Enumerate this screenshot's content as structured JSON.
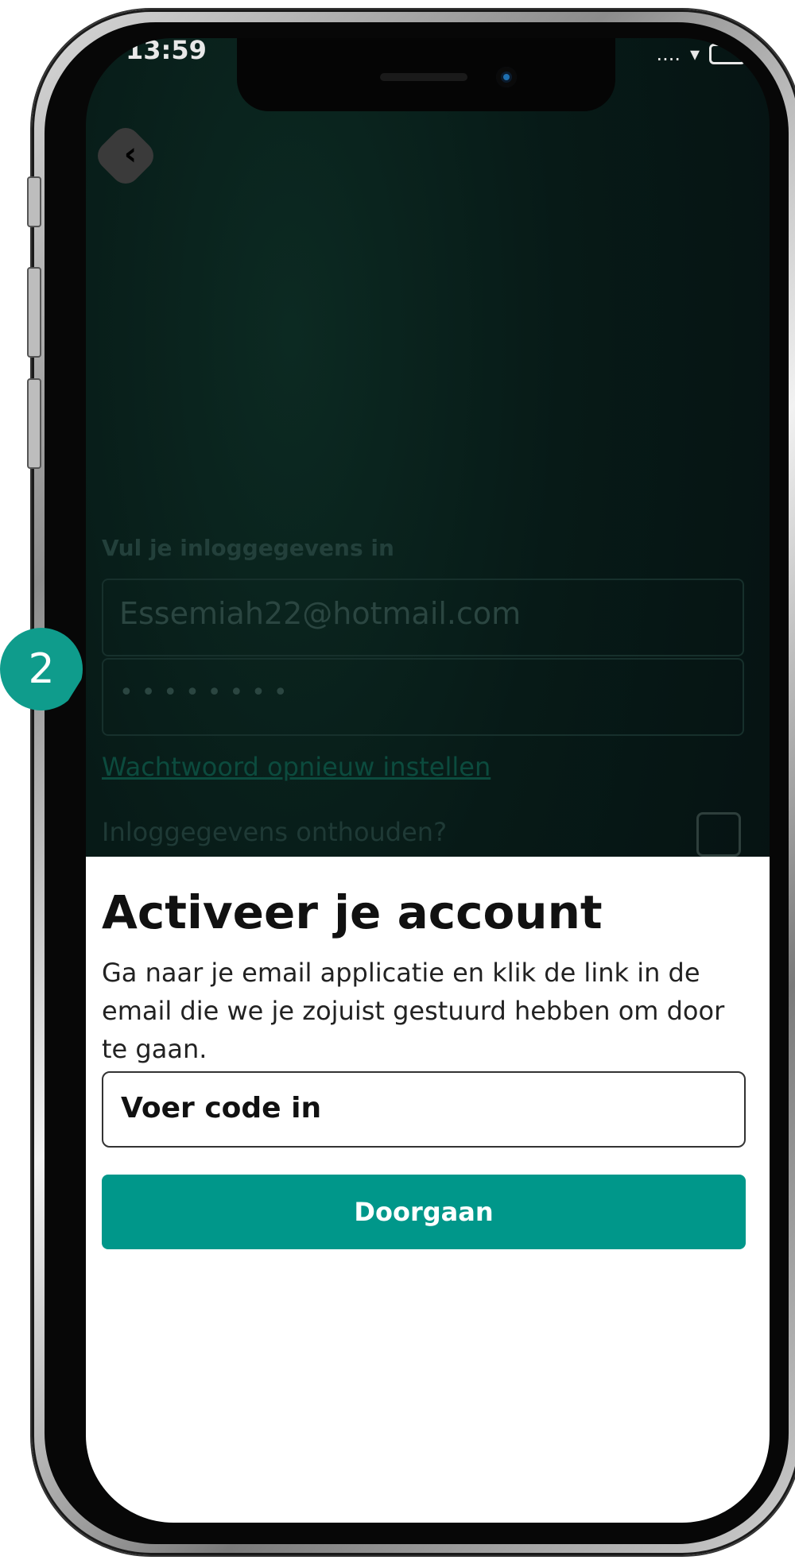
{
  "status_bar": {
    "time": "13:59",
    "signal": "....",
    "wifi_icon": "wifi-icon",
    "battery_icon": "battery-icon"
  },
  "back_icon": "chevron-left-icon",
  "login_form": {
    "title": "Vul je inloggegevens in",
    "email_value": "Essemiah22@hotmail.com",
    "password_value": "••••••••",
    "reset_link": "Wachtwoord opnieuw instellen",
    "remember_label": "Inloggegevens onthouden?"
  },
  "activate_sheet": {
    "title": "Activeer je account",
    "body": "Ga naar je email applicatie en klik de link in de email die we je zojuist gestuurd hebben om door te gaan.",
    "code_placeholder": "Voer code in",
    "continue_label": "Doorgaan"
  },
  "step_badge": "2",
  "colors": {
    "accent": "#00978a",
    "badge": "#0f9c8c",
    "screen_bg": "#050f10"
  }
}
